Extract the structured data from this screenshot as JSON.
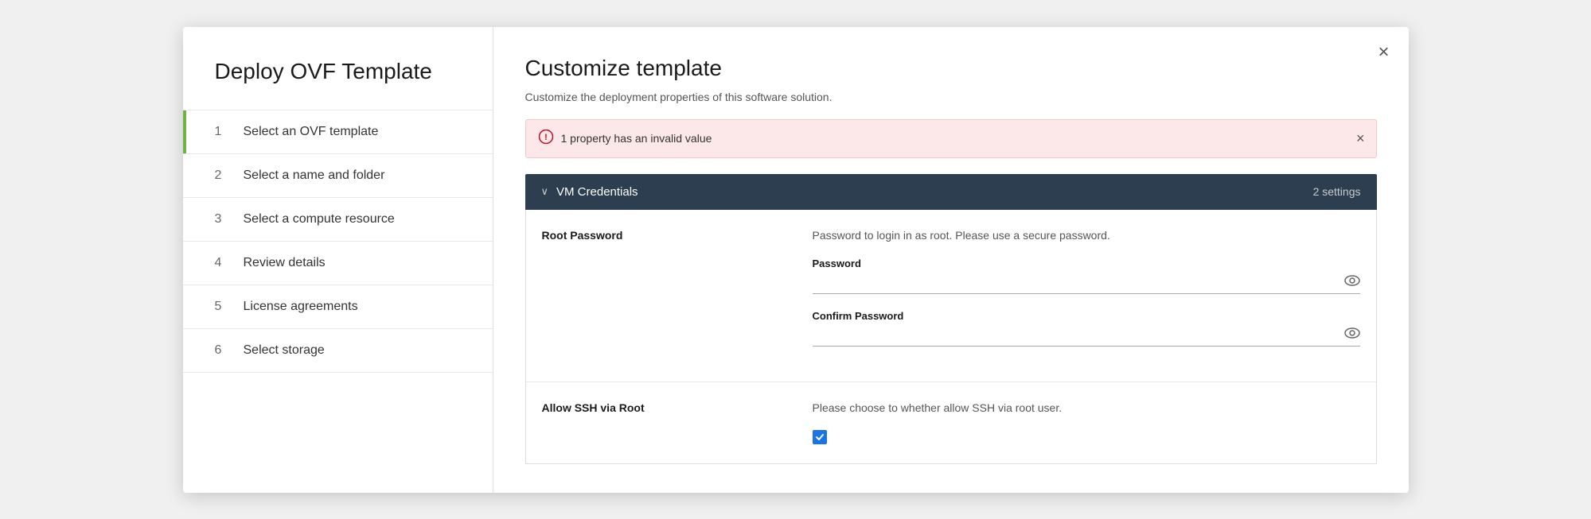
{
  "dialog": {
    "title": "Deploy OVF Template",
    "close_label": "×"
  },
  "sidebar": {
    "steps": [
      {
        "num": "1",
        "label": "Select an OVF template",
        "active": false
      },
      {
        "num": "2",
        "label": "Select a name and folder",
        "active": false
      },
      {
        "num": "3",
        "label": "Select a compute resource",
        "active": false
      },
      {
        "num": "4",
        "label": "Review details",
        "active": false
      },
      {
        "num": "5",
        "label": "License agreements",
        "active": false
      },
      {
        "num": "6",
        "label": "Select storage",
        "active": false
      }
    ]
  },
  "content": {
    "title": "Customize template",
    "subtitle": "Customize the deployment properties of this software solution.",
    "error_banner": {
      "text": "1 property has an invalid value"
    },
    "section": {
      "title": "VM Credentials",
      "count": "2 settings",
      "rows": [
        {
          "id": "root-password",
          "label": "Root Password",
          "description": "Password to login in as root. Please use a secure password.",
          "fields": [
            {
              "id": "password",
              "label": "Password",
              "type": "password",
              "placeholder": ""
            },
            {
              "id": "confirm-password",
              "label": "Confirm Password",
              "type": "password",
              "placeholder": ""
            }
          ]
        },
        {
          "id": "allow-ssh",
          "label": "Allow SSH via Root",
          "description": "Please choose to whether allow SSH via root user.",
          "checked": true
        }
      ]
    }
  },
  "icons": {
    "chevron_down": "∨",
    "eye": "👁",
    "close": "×",
    "error_circle": "⊘",
    "checkmark": "✓"
  }
}
